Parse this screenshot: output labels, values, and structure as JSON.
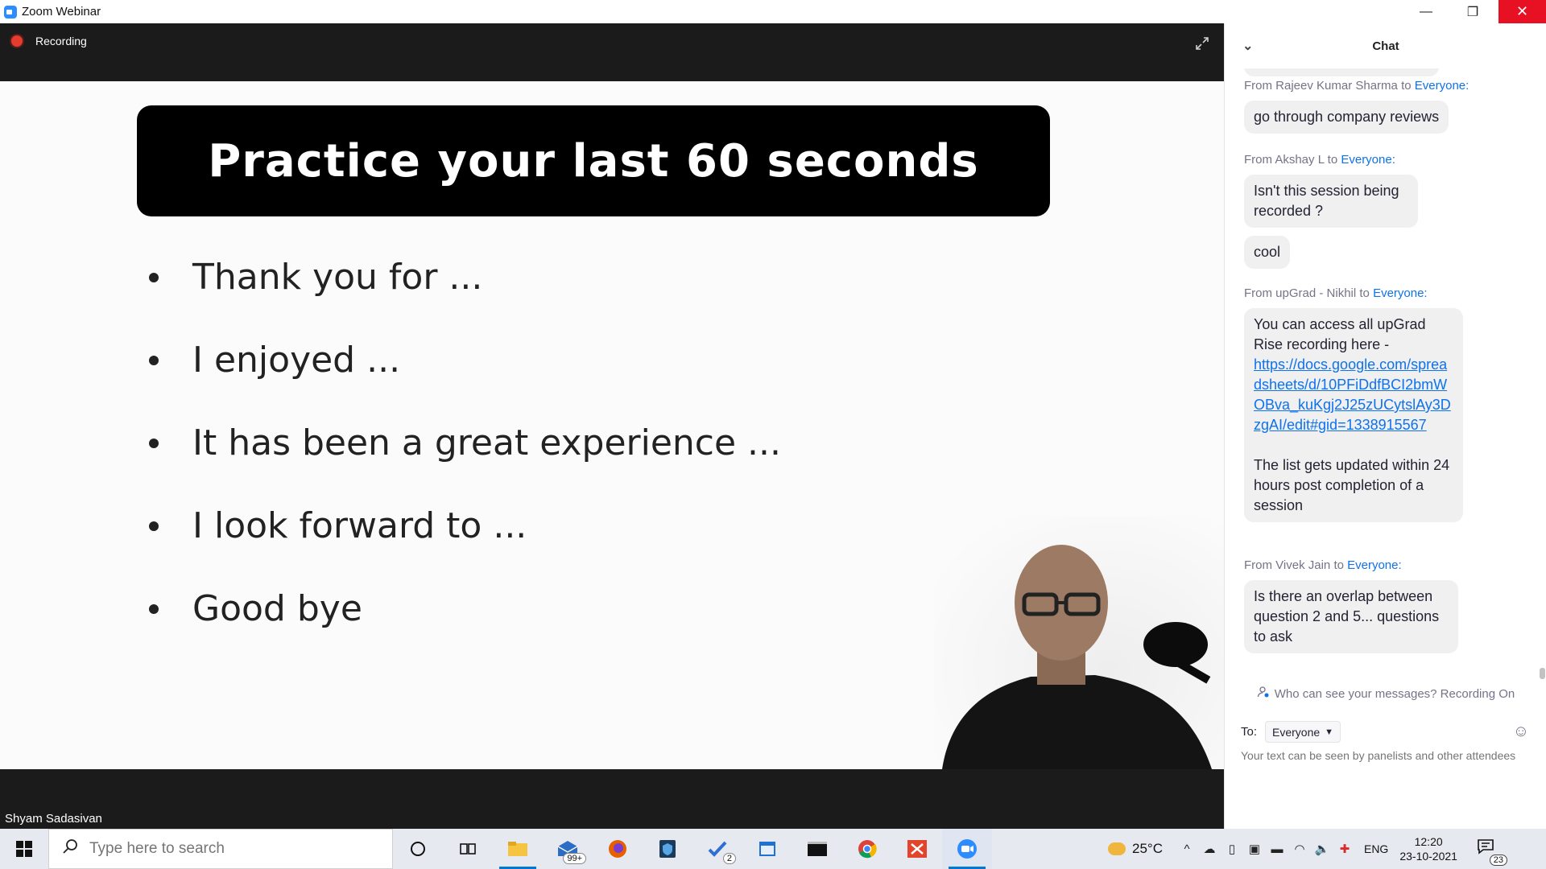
{
  "window": {
    "title": "Zoom Webinar",
    "minimize_glyph": "—",
    "restore_glyph": "❐",
    "close_glyph": "✕"
  },
  "meeting": {
    "recording_label": "Recording",
    "speaker_name": "Shyam Sadasivan"
  },
  "slide": {
    "title": "Practice your last 60 seconds",
    "bullets": [
      "Thank you for ...",
      "I enjoyed ...",
      "It has been a great experience ...",
      "I look forward to ...",
      "Good bye"
    ]
  },
  "chat": {
    "header": "Chat",
    "messages": [
      {
        "from": "From Rajeev Kumar Sharma",
        "to_word": "to",
        "to": "Everyone:",
        "bubbles": [
          "go through company reviews"
        ]
      },
      {
        "from": "From Akshay L",
        "to_word": "to",
        "to": "Everyone:",
        "bubbles": [
          "Isn't this session being recorded ?",
          "cool"
        ]
      },
      {
        "from": "From upGrad - Nikhil",
        "to_word": "to",
        "to": "Everyone:",
        "text_before": "You can access all upGrad Rise recording here -",
        "link": "https://docs.google.com/spreadsheets/d/10PFiDdfBCI2bmWOBva_kuKgj2J25zUCytslAy3DzgAI/edit#gid=1338915567",
        "text_after": "The list gets updated within 24 hours post completion of a session"
      },
      {
        "from": "From Vivek Jain",
        "to_word": "to",
        "to": "Everyone:",
        "bubbles": [
          "Is there an overlap between question 2 and 5... questions to ask"
        ]
      }
    ],
    "privacy_note": "Who can see your messages? Recording On",
    "to_label": "To:",
    "to_value": "Everyone",
    "input_placeholder": "Your text can be seen by panelists and other attendees"
  },
  "taskbar": {
    "search_placeholder": "Type here to search",
    "mail_badge": "99+",
    "todo_badge": "2",
    "temperature": "25°C",
    "language": "ENG",
    "time": "12:20",
    "date": "23-10-2021",
    "notification_count": "23"
  },
  "colors": {
    "accent": "#0e72ed",
    "close_button": "#E81123",
    "recording_dot": "#e23d2e",
    "video_bg": "#1b1b1b"
  }
}
